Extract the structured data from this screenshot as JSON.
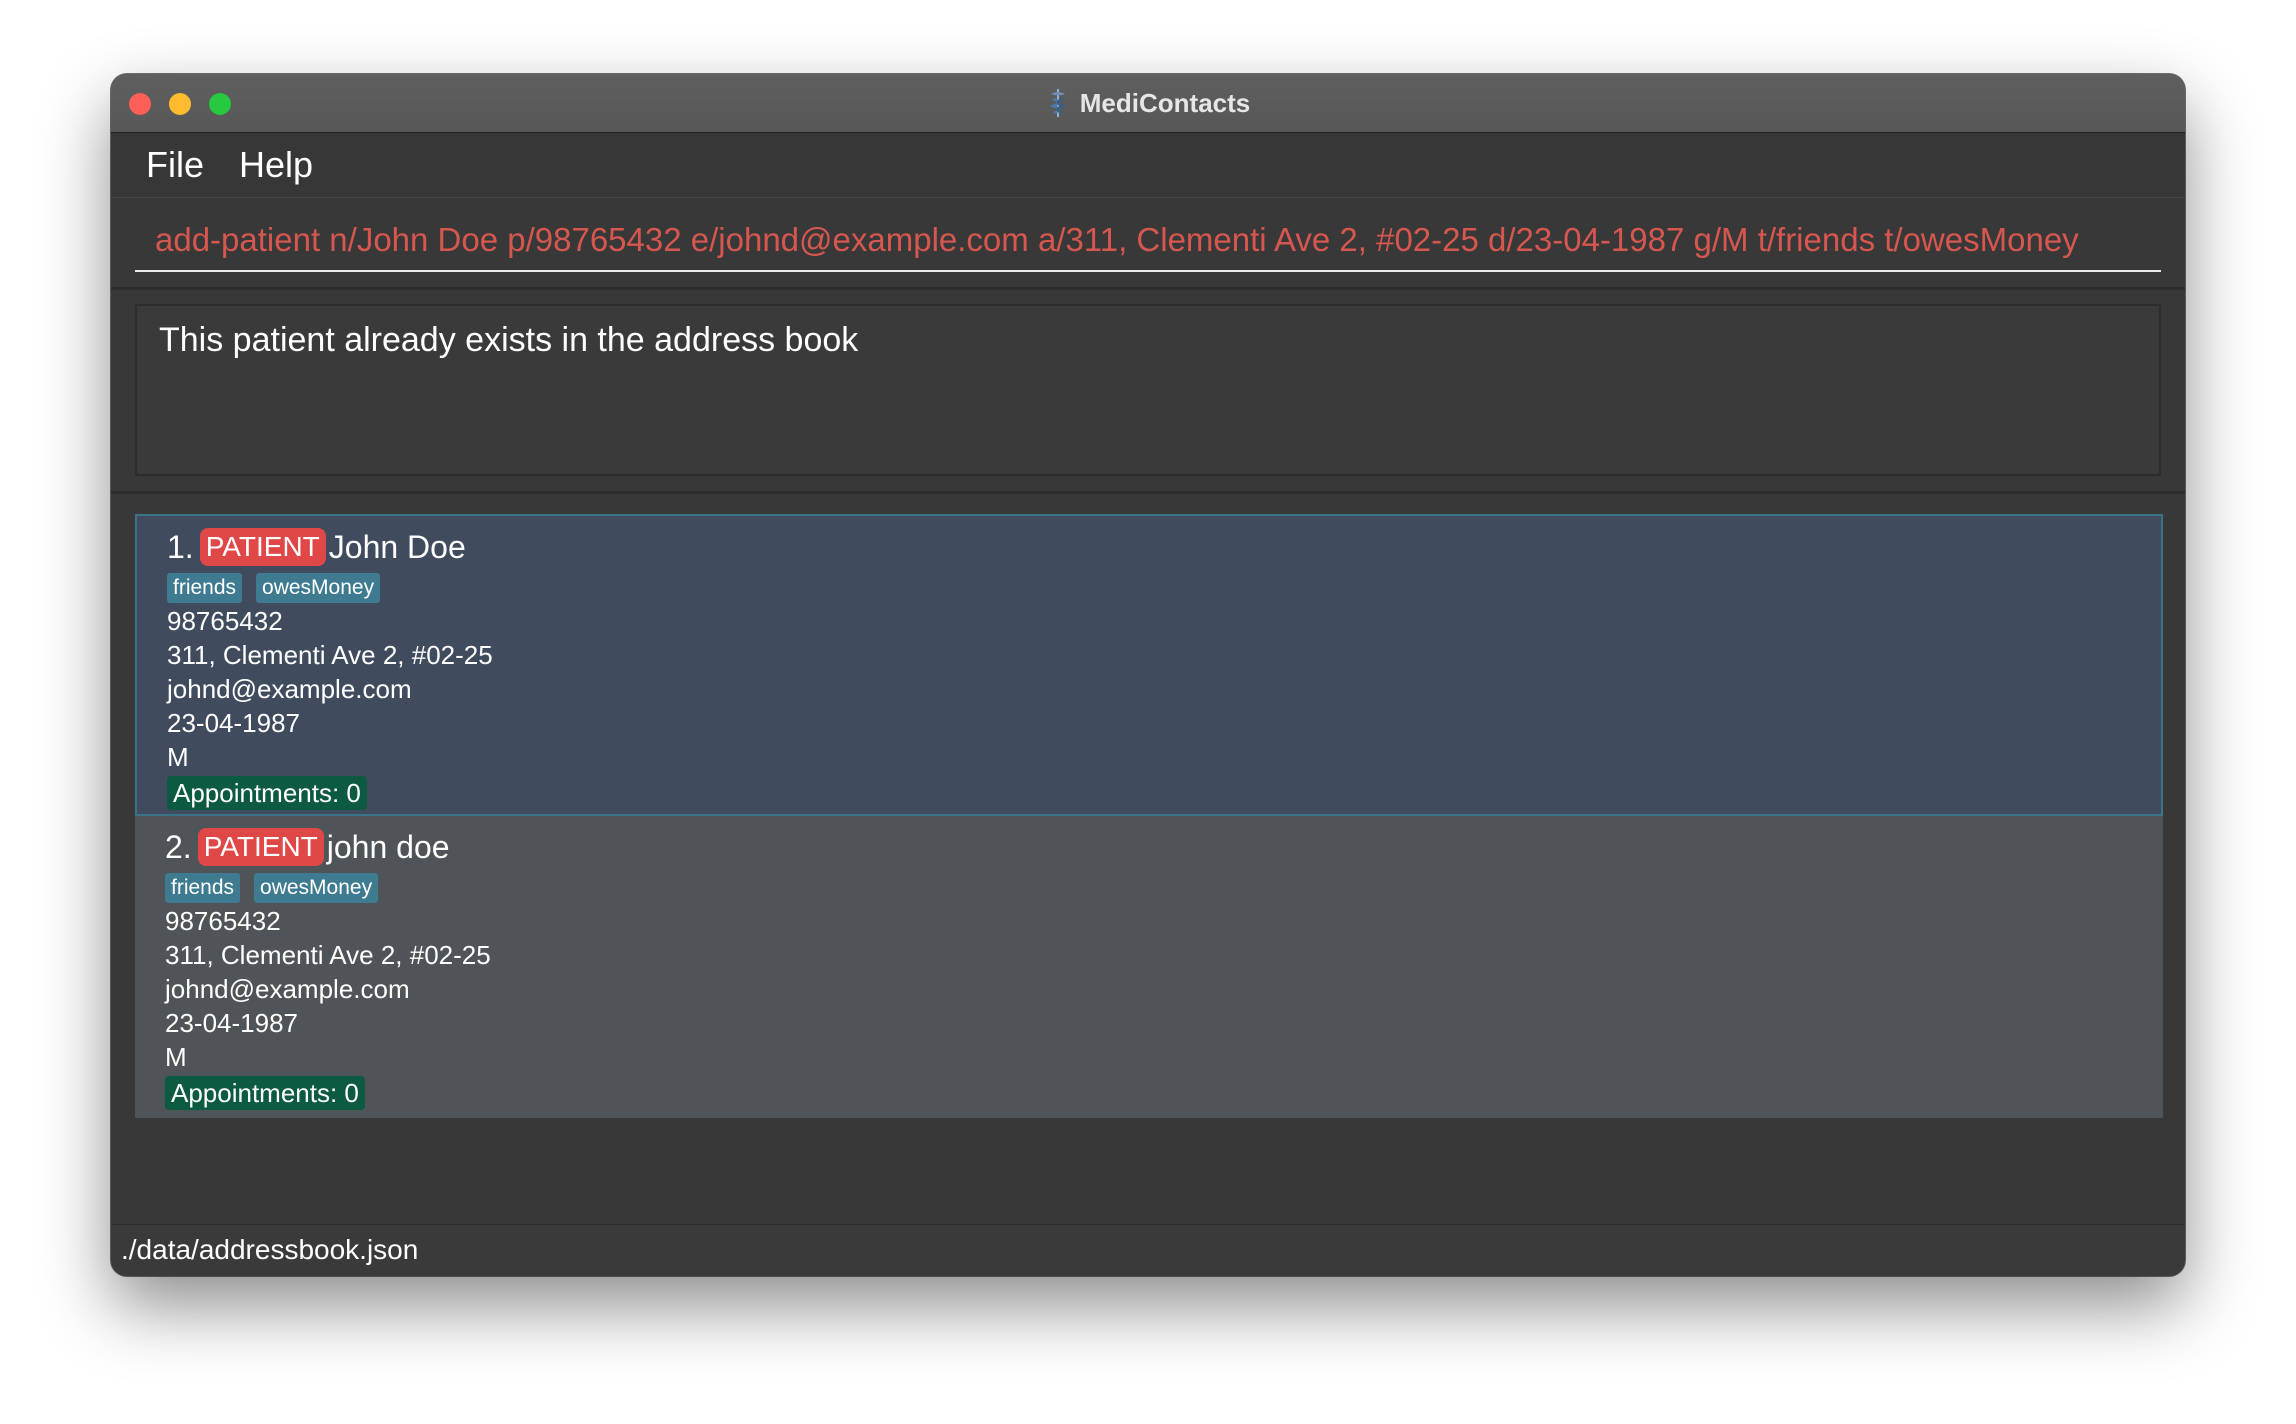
{
  "window": {
    "title": "MediContacts",
    "app_icon": "caduceus-icon"
  },
  "menu": {
    "items": [
      {
        "label": "File"
      },
      {
        "label": "Help"
      }
    ]
  },
  "command": {
    "value": "add-patient n/John Doe p/98765432 e/johnd@example.com a/311, Clementi Ave 2, #02-25 d/23-04-1987 g/M t/friends t/owesMoney"
  },
  "result": {
    "message": "This patient already exists in the address book"
  },
  "patients": [
    {
      "index": "1.",
      "badge": "PATIENT",
      "name": "John Doe",
      "tags": [
        "friends",
        "owesMoney"
      ],
      "phone": "98765432",
      "address": "311, Clementi Ave 2, #02-25",
      "email": "johnd@example.com",
      "dob": "23-04-1987",
      "gender": "M",
      "appointments": "Appointments: 0",
      "selected": true
    },
    {
      "index": "2.",
      "badge": "PATIENT",
      "name": "john doe",
      "tags": [
        "friends",
        "owesMoney"
      ],
      "phone": "98765432",
      "address": "311, Clementi Ave 2, #02-25",
      "email": "johnd@example.com",
      "dob": "23-04-1987",
      "gender": "M",
      "appointments": "Appointments: 0",
      "selected": false
    }
  ],
  "status": {
    "path": "./data/addressbook.json"
  },
  "colors": {
    "command_text": "#d6574f",
    "patient_badge": "#e04848",
    "tag": "#3e7b91",
    "appointments": "#0c5a42",
    "selected_card": "#414b5e",
    "normal_card": "#4e5457"
  }
}
